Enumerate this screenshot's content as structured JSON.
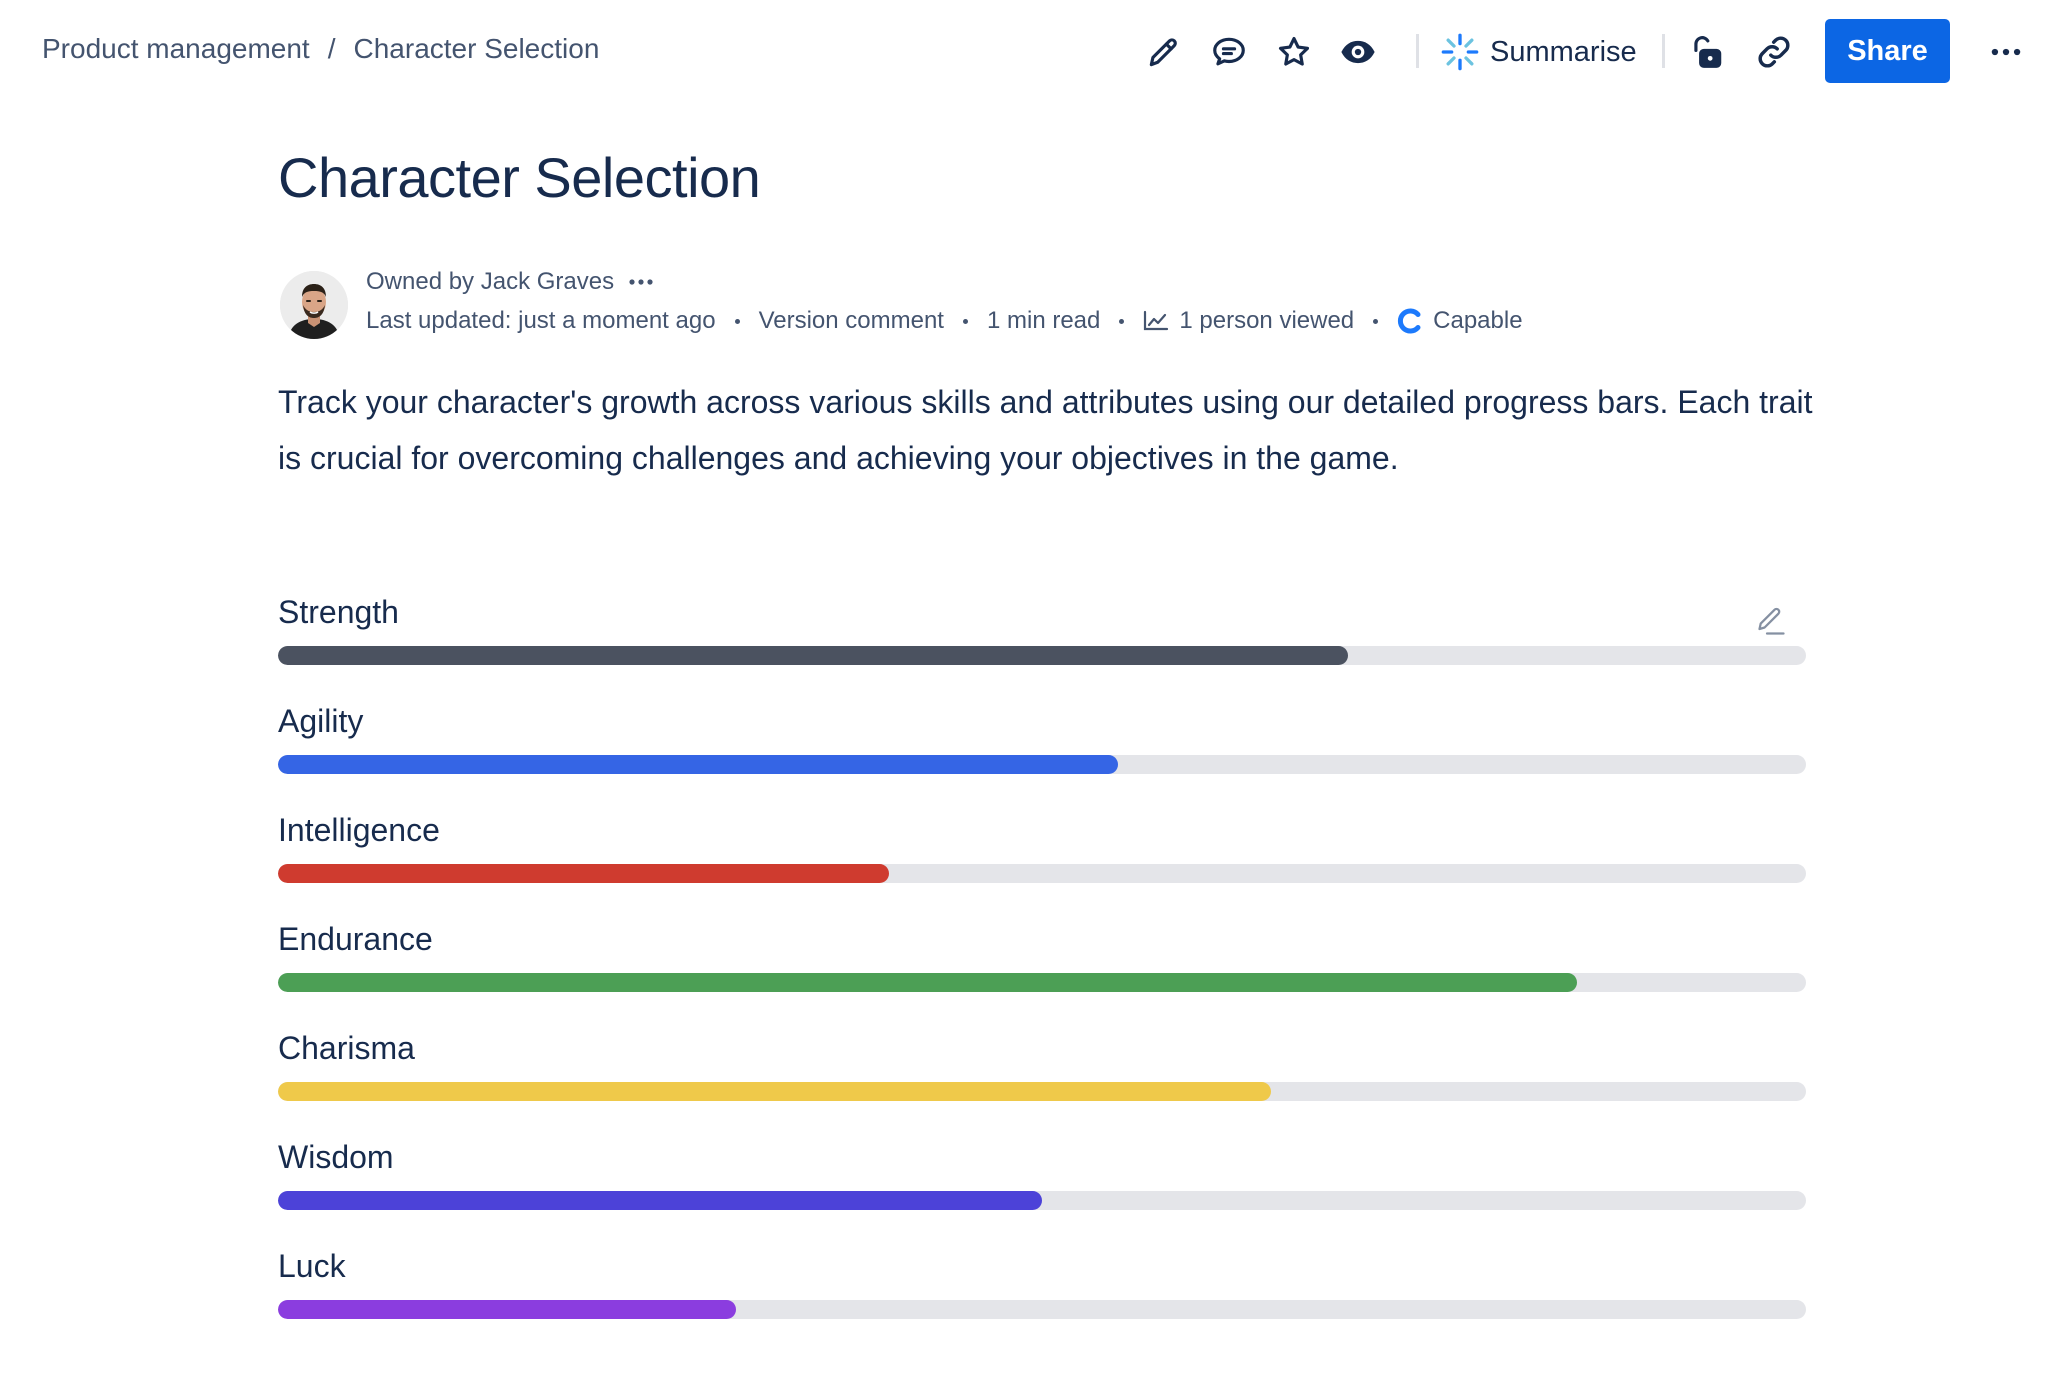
{
  "breadcrumb": {
    "parent": "Product management",
    "separator": "/",
    "current": "Character Selection"
  },
  "toolbar": {
    "icons": [
      "pencil-icon",
      "comment-icon",
      "star-icon",
      "eye-icon",
      "sparkle-icon",
      "unlock-icon",
      "link-icon",
      "more-icon"
    ],
    "summarise_label": "Summarise",
    "share_label": "Share",
    "accent_color": "#0c66e4"
  },
  "page": {
    "title": "Character Selection",
    "owner_text": "Owned by Jack Graves",
    "last_updated": "Last updated: just a moment ago",
    "version_comment": "Version comment",
    "read_time": "1 min read",
    "viewers": "1 person viewed",
    "status": "Capable",
    "description": "Track your character's growth across various skills and attributes using our detailed progress bars. Each trait is crucial for overcoming challenges and achieving your objectives in the game."
  },
  "traits": [
    {
      "label": "Strength",
      "progress": 0.7,
      "color": "#4b5260"
    },
    {
      "label": "Agility",
      "progress": 0.55,
      "color": "#3565e5"
    },
    {
      "label": "Intelligence",
      "progress": 0.4,
      "color": "#cf3b2f"
    },
    {
      "label": "Endurance",
      "progress": 0.85,
      "color": "#4c9f55"
    },
    {
      "label": "Charisma",
      "progress": 0.65,
      "color": "#efc94a"
    },
    {
      "label": "Wisdom",
      "progress": 0.5,
      "color": "#4c42d8"
    },
    {
      "label": "Luck",
      "progress": 0.3,
      "color": "#8b3ddf"
    }
  ]
}
